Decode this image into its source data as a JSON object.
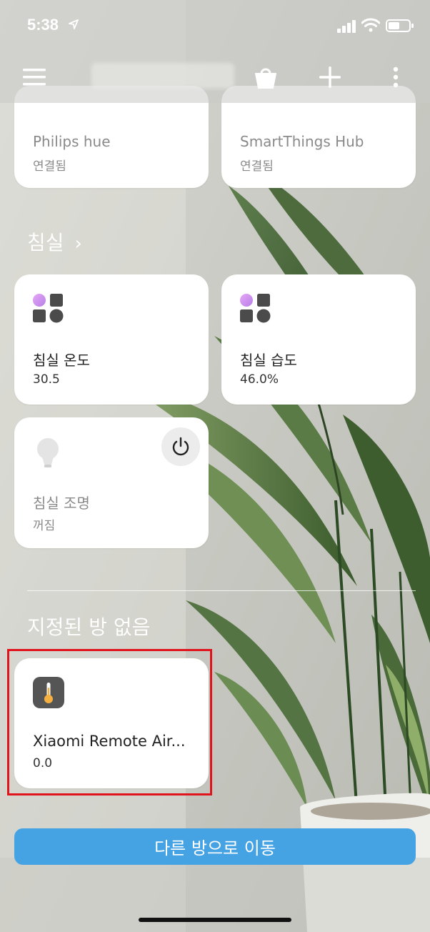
{
  "status_bar": {
    "time": "5:38",
    "icons": [
      "location-arrow-icon",
      "signal-icon",
      "wifi-icon",
      "battery-icon"
    ]
  },
  "app_bar": {
    "icons": [
      "menu-icon",
      "shopping-bag-icon",
      "plus-icon",
      "more-vertical-icon"
    ]
  },
  "top_devices": [
    {
      "name": "Philips hue",
      "status": "연결됨"
    },
    {
      "name": "SmartThings Hub",
      "status": "연결됨"
    }
  ],
  "room": {
    "title": "침실",
    "chevron": "›",
    "devices": [
      {
        "name": "침실 온도",
        "status": "30.5",
        "icon": "sensor-shapes-icon"
      },
      {
        "name": "침실 습도",
        "status": "46.0%",
        "icon": "sensor-shapes-icon"
      },
      {
        "name": "침실 조명",
        "status": "꺼짐",
        "icon": "light-bulb-icon"
      }
    ]
  },
  "unassigned": {
    "title": "지정된 방 없음",
    "devices": [
      {
        "name": "Xiaomi Remote Air...",
        "status": "0.0",
        "icon": "thermometer-icon"
      }
    ]
  },
  "move_button": {
    "label": "다른 방으로 이동"
  },
  "colors": {
    "accent_blue": "#45a3e3",
    "highlight_red": "#e0141c",
    "sensor_gradient_start": "#e6a7f5",
    "sensor_gradient_end": "#b77ee8",
    "thermometer_bg": "#555555",
    "thermometer_fill": "#f5b042"
  }
}
